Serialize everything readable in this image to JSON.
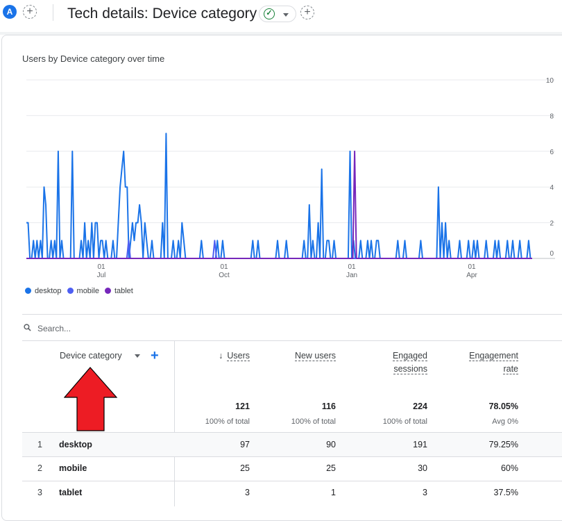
{
  "header": {
    "avatar_letter": "A",
    "add_comparison_icon": "plus-icon",
    "title": "Tech details: Device category",
    "status_icon": "check-circle-icon",
    "add_report_icon": "plus-icon"
  },
  "card": {
    "chart_title": "Users by Device category over time"
  },
  "chart_data": {
    "type": "line",
    "y_ticks": [
      "0",
      "2",
      "4",
      "6",
      "8",
      "10"
    ],
    "ylim": [
      0,
      10
    ],
    "x_ticks": [
      {
        "day": "01",
        "month": "Jul"
      },
      {
        "day": "01",
        "month": "Oct"
      },
      {
        "day": "01",
        "month": "Jan"
      },
      {
        "day": "01",
        "month": "Apr"
      }
    ],
    "grid": true,
    "legend_placement": "bottom-left",
    "series": [
      {
        "name": "desktop",
        "color": "#1a73e8",
        "values": [
          2,
          2,
          0,
          0,
          1,
          0,
          1,
          0,
          1,
          0,
          4,
          3,
          0,
          0,
          1,
          0,
          1,
          0,
          6,
          0,
          1,
          0,
          0,
          0,
          0,
          0,
          6,
          0,
          0,
          0,
          0,
          1,
          0,
          2,
          0,
          1,
          0,
          2,
          0,
          2,
          2,
          0,
          1,
          1,
          0,
          1,
          0,
          0,
          0,
          1,
          0,
          0,
          2,
          4,
          5,
          6,
          4,
          4,
          0,
          1,
          2,
          1,
          2,
          2,
          3,
          2,
          0,
          2,
          1,
          0,
          0,
          1,
          0,
          0,
          0,
          0,
          0,
          2,
          0,
          7,
          0,
          0,
          0,
          1,
          0,
          0,
          1,
          0,
          2,
          1,
          0,
          0,
          0,
          0,
          0,
          0,
          0,
          0,
          0,
          1,
          0,
          0,
          0,
          0,
          0,
          0,
          0,
          0,
          1,
          0,
          0,
          1,
          0,
          0,
          0,
          0,
          0,
          0,
          0,
          0,
          0,
          0,
          0,
          0,
          0,
          0,
          0,
          0,
          1,
          0,
          0,
          1,
          0,
          0,
          0,
          0,
          0,
          0,
          0,
          0,
          0,
          0,
          1,
          0,
          0,
          0,
          0,
          1,
          0,
          0,
          0,
          0,
          0,
          0,
          0,
          0,
          0,
          1,
          0,
          0,
          3,
          0,
          1,
          0,
          0,
          2,
          0,
          5,
          0,
          0,
          1,
          1,
          0,
          0,
          1,
          0,
          0,
          0,
          0,
          0,
          0,
          0,
          0,
          6,
          0,
          1,
          0,
          0,
          0,
          1,
          0,
          0,
          0,
          1,
          0,
          1,
          0,
          0,
          1,
          1,
          0,
          0,
          0,
          0,
          0,
          0,
          0,
          0,
          0,
          0,
          1,
          0,
          0,
          0,
          1,
          0,
          0,
          0,
          0,
          0,
          0,
          0,
          0,
          1,
          0,
          0,
          0,
          0,
          0,
          0,
          0,
          0,
          0,
          4,
          0,
          2,
          0,
          2,
          0,
          1,
          0,
          0,
          0,
          0,
          0,
          1,
          0,
          0,
          0,
          0,
          1,
          0,
          0,
          1,
          0,
          1,
          0,
          0,
          0,
          0,
          1,
          0,
          0,
          0,
          0,
          1,
          0,
          1,
          0,
          0,
          0,
          0,
          1,
          0,
          0,
          1,
          0,
          0,
          0,
          1,
          0,
          0,
          0,
          0,
          1,
          0,
          0
        ],
        "note": ""
      },
      {
        "name": "mobile",
        "color": "#4e5ff2",
        "values": [
          0,
          0,
          0,
          0,
          0,
          0,
          0,
          0,
          0,
          0,
          0,
          0,
          0,
          0,
          0,
          0,
          0,
          0,
          0,
          0,
          0,
          0,
          0,
          0,
          0,
          0,
          0,
          0,
          0,
          0,
          0,
          0,
          0,
          0,
          0,
          0,
          0,
          0,
          0,
          0,
          0,
          0,
          0,
          0,
          0,
          0,
          0,
          0,
          0,
          0,
          0,
          0,
          0,
          0,
          0,
          0,
          0,
          1,
          0,
          0,
          0,
          0,
          0,
          0,
          0,
          0,
          0,
          0,
          0,
          0,
          0,
          0,
          0,
          0,
          0,
          0,
          0,
          0,
          0,
          0,
          0,
          0,
          0,
          0,
          0,
          0,
          0,
          0,
          0,
          0,
          0,
          0,
          0,
          0,
          0,
          0,
          0,
          0,
          0,
          0,
          0,
          0,
          0,
          0,
          0,
          1,
          0,
          0,
          0,
          0,
          0,
          0,
          0,
          0,
          0,
          0,
          0,
          0,
          0,
          0,
          0,
          0,
          0,
          0,
          0,
          0,
          0,
          0,
          0,
          0,
          0,
          0,
          0,
          0,
          0,
          0,
          0,
          0,
          0,
          0,
          0,
          0,
          0,
          0,
          0,
          0,
          0,
          0,
          0,
          0,
          0,
          0,
          0,
          0,
          0,
          0,
          0,
          0,
          0,
          0,
          0,
          0,
          0,
          0,
          0,
          0,
          0,
          0,
          0,
          0,
          0,
          0,
          0,
          0,
          0,
          0,
          0,
          0,
          0,
          0,
          0,
          0,
          0,
          0,
          0,
          0,
          0,
          0,
          0,
          0,
          0,
          0,
          0,
          0,
          0,
          0,
          0,
          0,
          0,
          0,
          0,
          0,
          0,
          0,
          0,
          0,
          0,
          0,
          0,
          0,
          0,
          0,
          0,
          0,
          0,
          0,
          0,
          0,
          0,
          0,
          0,
          0,
          0,
          0,
          0,
          0,
          0,
          0,
          0,
          0,
          0,
          0,
          0,
          0,
          0,
          0,
          0,
          0,
          0,
          0,
          0,
          0,
          0,
          0,
          0,
          0,
          0,
          0,
          0,
          0,
          0,
          0,
          0,
          0,
          0,
          0,
          0,
          0,
          0,
          0,
          0,
          0,
          0,
          0,
          0,
          0,
          0,
          0,
          0,
          0,
          0,
          0,
          0,
          0,
          0,
          0,
          0,
          0,
          0,
          0,
          0,
          0,
          0
        ]
      },
      {
        "name": "tablet",
        "color": "#7627bb",
        "values": [
          0,
          0,
          0,
          0,
          0,
          0,
          0,
          0,
          0,
          0,
          0,
          0,
          0,
          0,
          0,
          0,
          0,
          0,
          0,
          0,
          0,
          0,
          0,
          0,
          0,
          0,
          0,
          0,
          0,
          0,
          0,
          0,
          0,
          0,
          0,
          0,
          0,
          0,
          0,
          0,
          0,
          0,
          0,
          0,
          0,
          0,
          0,
          0,
          0,
          0,
          0,
          0,
          0,
          0,
          0,
          0,
          0,
          0,
          0,
          0,
          0,
          0,
          0,
          0,
          0,
          0,
          0,
          0,
          0,
          0,
          0,
          0,
          0,
          0,
          0,
          0,
          0,
          0,
          0,
          0,
          0,
          0,
          0,
          0,
          0,
          0,
          0,
          0,
          0,
          0,
          0,
          0,
          0,
          0,
          0,
          0,
          0,
          0,
          0,
          0,
          0,
          0,
          0,
          0,
          0,
          0,
          0,
          0,
          0,
          0,
          0,
          0,
          0,
          0,
          0,
          0,
          0,
          0,
          0,
          0,
          0,
          0,
          0,
          0,
          0,
          0,
          0,
          0,
          0,
          0,
          0,
          0,
          0,
          0,
          0,
          0,
          0,
          0,
          0,
          0,
          0,
          0,
          0,
          0,
          0,
          0,
          0,
          0,
          0,
          0,
          0,
          0,
          0,
          0,
          0,
          0,
          0,
          0,
          0,
          0,
          0,
          0,
          0,
          0,
          0,
          0,
          0,
          0,
          0,
          0,
          0,
          0,
          0,
          0,
          0,
          0,
          0,
          0,
          0,
          0,
          0,
          0,
          0,
          6,
          0,
          0,
          0,
          0,
          0,
          0,
          0,
          0,
          0,
          0,
          0,
          0,
          0,
          0,
          0,
          0,
          0,
          0,
          0,
          0,
          0,
          0,
          0,
          0,
          0,
          0,
          0,
          0,
          0,
          0,
          0,
          0,
          0,
          0,
          0,
          0,
          0,
          0,
          0,
          0,
          0,
          0,
          0,
          0,
          0,
          0,
          0,
          0,
          0,
          0,
          0,
          0,
          0,
          0,
          0,
          0,
          0,
          0,
          0,
          0,
          0,
          0,
          0,
          0,
          0,
          0,
          0,
          0,
          0,
          0,
          0,
          0,
          0,
          0,
          0,
          0,
          0,
          0,
          0,
          0,
          0,
          0,
          0,
          0,
          0,
          0,
          0,
          0,
          0,
          0,
          0,
          0,
          0,
          0,
          0,
          0,
          0,
          0,
          0
        ]
      }
    ]
  },
  "legend": [
    {
      "label": "desktop",
      "color": "#1a73e8"
    },
    {
      "label": "mobile",
      "color": "#4e5ff2"
    },
    {
      "label": "tablet",
      "color": "#7627bb"
    }
  ],
  "search": {
    "placeholder": "Search..."
  },
  "table": {
    "dimension_header": "Device category",
    "metrics": [
      {
        "line1": "Users",
        "line2": "",
        "sorted": true
      },
      {
        "line1": "New users",
        "line2": "",
        "sorted": false
      },
      {
        "line1": "Engaged",
        "line2": "sessions",
        "sorted": false
      },
      {
        "line1": "Engagement",
        "line2": "rate",
        "sorted": false
      }
    ],
    "totals": [
      "121",
      "116",
      "224",
      "78.05%"
    ],
    "subtotals": [
      "100% of total",
      "100% of total",
      "100% of total",
      "Avg 0%"
    ],
    "rows": [
      {
        "num": "1",
        "label": "desktop",
        "values": [
          "97",
          "90",
          "191",
          "79.25%"
        ]
      },
      {
        "num": "2",
        "label": "mobile",
        "values": [
          "25",
          "25",
          "30",
          "60%"
        ]
      },
      {
        "num": "3",
        "label": "tablet",
        "values": [
          "3",
          "1",
          "3",
          "37.5%"
        ]
      }
    ]
  },
  "annotation": {
    "arrow_color": "#ed1c24"
  }
}
